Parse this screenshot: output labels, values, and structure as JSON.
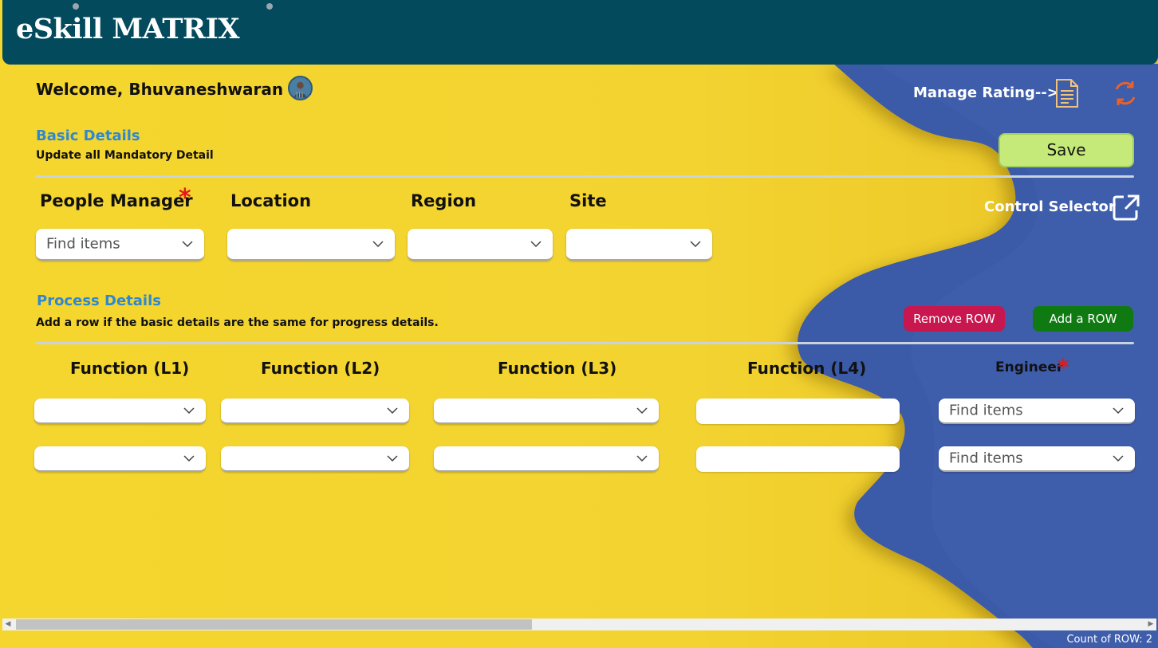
{
  "app": {
    "title": "eSkill MATRIX"
  },
  "header": {
    "welcome": "Welcome, Bhuvaneshwaran C !",
    "manage_rating": "Manage Rating-->",
    "control_selector": "Control Selector"
  },
  "basic_details": {
    "title": "Basic Details",
    "subtitle": "Update all Mandatory Detail",
    "save_label": "Save",
    "fields": {
      "people_manager": {
        "label": "People Manager",
        "required": true,
        "placeholder": "Find items"
      },
      "location": {
        "label": "Location",
        "value": ""
      },
      "region": {
        "label": "Region",
        "value": ""
      },
      "site": {
        "label": "Site",
        "value": ""
      }
    }
  },
  "process_details": {
    "title": "Process Details",
    "subtitle": "Add a row if the basic details are the same for progress details.",
    "remove_row_label": "Remove ROW",
    "add_row_label": "Add a ROW",
    "columns": [
      "Function (L1)",
      "Function (L2)",
      "Function (L3)",
      "Function (L4)",
      "Engineer"
    ],
    "engineer_placeholder": "Find items",
    "rows": [
      {
        "l1": "",
        "l2": "",
        "l3": "",
        "l4": "",
        "engineer": ""
      },
      {
        "l1": "",
        "l2": "",
        "l3": "",
        "l4": "",
        "engineer": ""
      }
    ]
  },
  "status_bar": {
    "row_count": "Count of ROW: 2"
  },
  "colors": {
    "header_bg": "#034a5d",
    "background_yellow": "#f2d22c",
    "background_blue": "#3a5aa8",
    "section_title": "#2f88d0",
    "save_button": "#c6ea7a",
    "remove_button": "#c8164f",
    "add_button": "#0f7a12",
    "required_star": "#e11b1b",
    "refresh_icon": "#e8622a"
  },
  "icons": {
    "manage_rating": "document-icon",
    "refresh": "refresh-icon",
    "control_selector": "external-link-icon",
    "dropdown": "chevron-down-icon"
  }
}
